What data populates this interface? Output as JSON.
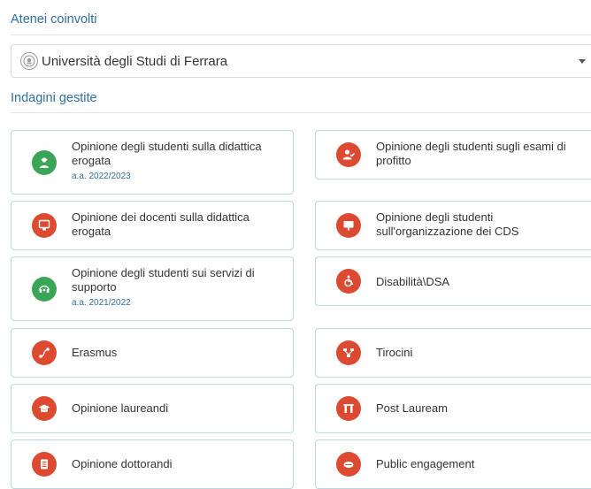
{
  "atenei": {
    "title": "Atenei coinvolti",
    "select_value": "Università degli Studi di Ferrara"
  },
  "indagini": {
    "title": "Indagini gestite",
    "cards": [
      {
        "label": "Opinione degli studenti sulla didattica erogata",
        "sub": "a.a. 2022/2023",
        "icon": "graduate-icon",
        "color": "#3aa655"
      },
      {
        "label": "Opinione degli studenti sugli esami di profitto",
        "sub": "",
        "icon": "user-check-icon",
        "color": "#dd4a32"
      },
      {
        "label": "Opinione dei docenti sulla didattica erogata",
        "sub": "",
        "icon": "teacher-board-icon",
        "color": "#dd4a32"
      },
      {
        "label": "Opinione degli studenti sull'organizzazione dei CDS",
        "sub": "",
        "icon": "presentation-icon",
        "color": "#dd4a32"
      },
      {
        "label": "Opinione degli studenti sui servizi di supporto",
        "sub": "a.a. 2021/2022",
        "icon": "headset-icon",
        "color": "#3aa655"
      },
      {
        "label": "Disabilità\\DSA",
        "sub": "",
        "icon": "wheelchair-icon",
        "color": "#dd4a32"
      },
      {
        "label": "Erasmus",
        "sub": "",
        "icon": "route-icon",
        "color": "#dd4a32"
      },
      {
        "label": "Tirocini",
        "sub": "",
        "icon": "network-icon",
        "color": "#dd4a32"
      },
      {
        "label": "Opinione laureandi",
        "sub": "",
        "icon": "mortarboard-icon",
        "color": "#dd4a32"
      },
      {
        "label": "Post Lauream",
        "sub": "",
        "icon": "gateway-icon",
        "color": "#dd4a32"
      },
      {
        "label": "Opinione dottorandi",
        "sub": "",
        "icon": "document-icon",
        "color": "#dd4a32"
      },
      {
        "label": "Public engagement",
        "sub": "",
        "icon": "handshake-icon",
        "color": "#dd4a32"
      }
    ]
  }
}
